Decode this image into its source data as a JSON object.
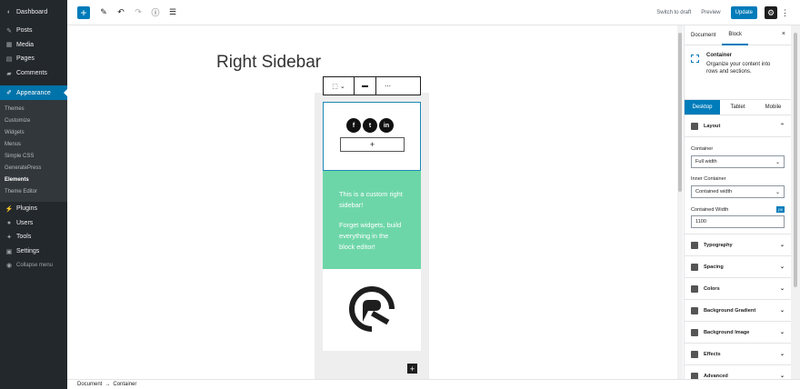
{
  "admin_menu": {
    "dashboard": "Dashboard",
    "posts": "Posts",
    "media": "Media",
    "pages": "Pages",
    "comments": "Comments",
    "appearance": "Appearance",
    "sub": [
      "Themes",
      "Customize",
      "Widgets",
      "Menus",
      "Simple CSS",
      "GeneratePress",
      "Elements",
      "Theme Editor"
    ],
    "current_sub": "Elements",
    "plugins": "Plugins",
    "users": "Users",
    "tools": "Tools",
    "settings": "Settings",
    "collapse": "Collapse menu"
  },
  "toolbar": {
    "switch_to_draft": "Switch to draft",
    "preview": "Preview",
    "update": "Update"
  },
  "editor": {
    "page_title": "Right Sidebar",
    "green_text_1": "This is a custom right sidebar!",
    "green_text_2": "Forget widgets, build everything in the block editor!",
    "social": [
      "f",
      "t",
      "in"
    ],
    "plus": "+"
  },
  "footer": {
    "breadcrumb_root": "Document",
    "arrow": "→",
    "breadcrumb_current": "Container"
  },
  "panel": {
    "tabs": [
      "Document",
      "Block"
    ],
    "active_tab": "Block",
    "close": "×",
    "block_title": "Container",
    "block_desc": "Organize your content into rows and sections.",
    "device_tabs": [
      "Desktop",
      "Tablet",
      "Mobile"
    ],
    "layout": {
      "title": "Layout",
      "container_label": "Container",
      "container_value": "Full width",
      "inner_label": "Inner Container",
      "inner_value": "Contained width",
      "width_label": "Contained Width",
      "width_unit": "px",
      "width_value": "1100"
    },
    "sections": [
      "Typography",
      "Spacing",
      "Colors",
      "Background Gradient",
      "Background Image",
      "Effects",
      "Advanced"
    ]
  },
  "colors": {
    "accent": "#007cba",
    "admin_bg": "#23282d",
    "green_box": "#6dd6a8"
  }
}
